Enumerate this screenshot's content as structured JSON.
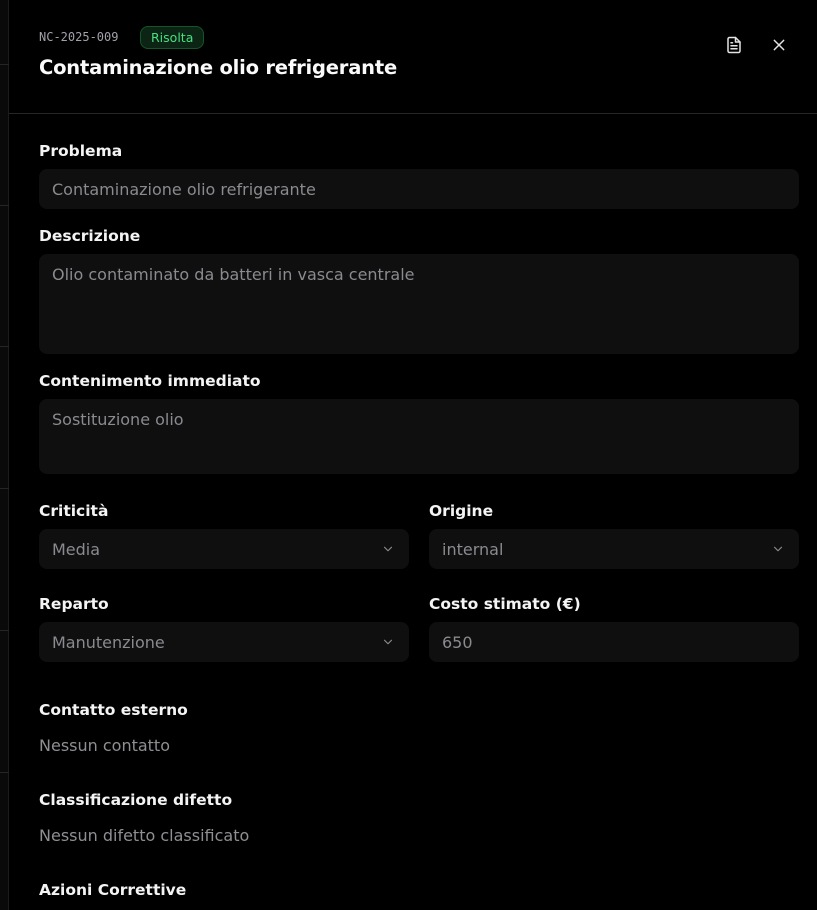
{
  "header": {
    "code": "NC-2025-009",
    "status": "Risolta",
    "title": "Contaminazione olio refrigerante"
  },
  "icons": {
    "document": "document-icon",
    "close": "close-icon",
    "chevron": "chevron-down-icon"
  },
  "form": {
    "problema": {
      "label": "Problema",
      "value": "Contaminazione olio refrigerante"
    },
    "descrizione": {
      "label": "Descrizione",
      "value": "Olio contaminato da batteri in vasca centrale"
    },
    "contenimento": {
      "label": "Contenimento immediato",
      "value": "Sostituzione olio"
    },
    "criticita": {
      "label": "Criticità",
      "value": "Media"
    },
    "origine": {
      "label": "Origine",
      "value": "internal"
    },
    "reparto": {
      "label": "Reparto",
      "value": "Manutenzione"
    },
    "costo": {
      "label": "Costo stimato (€)",
      "value": "650"
    },
    "contatto": {
      "label": "Contatto esterno",
      "value": "Nessun contatto"
    },
    "difetto": {
      "label": "Classificazione difetto",
      "value": "Nessun difetto classificato"
    },
    "azioni": {
      "label": "Azioni Correttive"
    }
  },
  "colors": {
    "background": "#000000",
    "field_background": "#0f0f10",
    "status_green": "#4ade80",
    "border": "#262626"
  }
}
